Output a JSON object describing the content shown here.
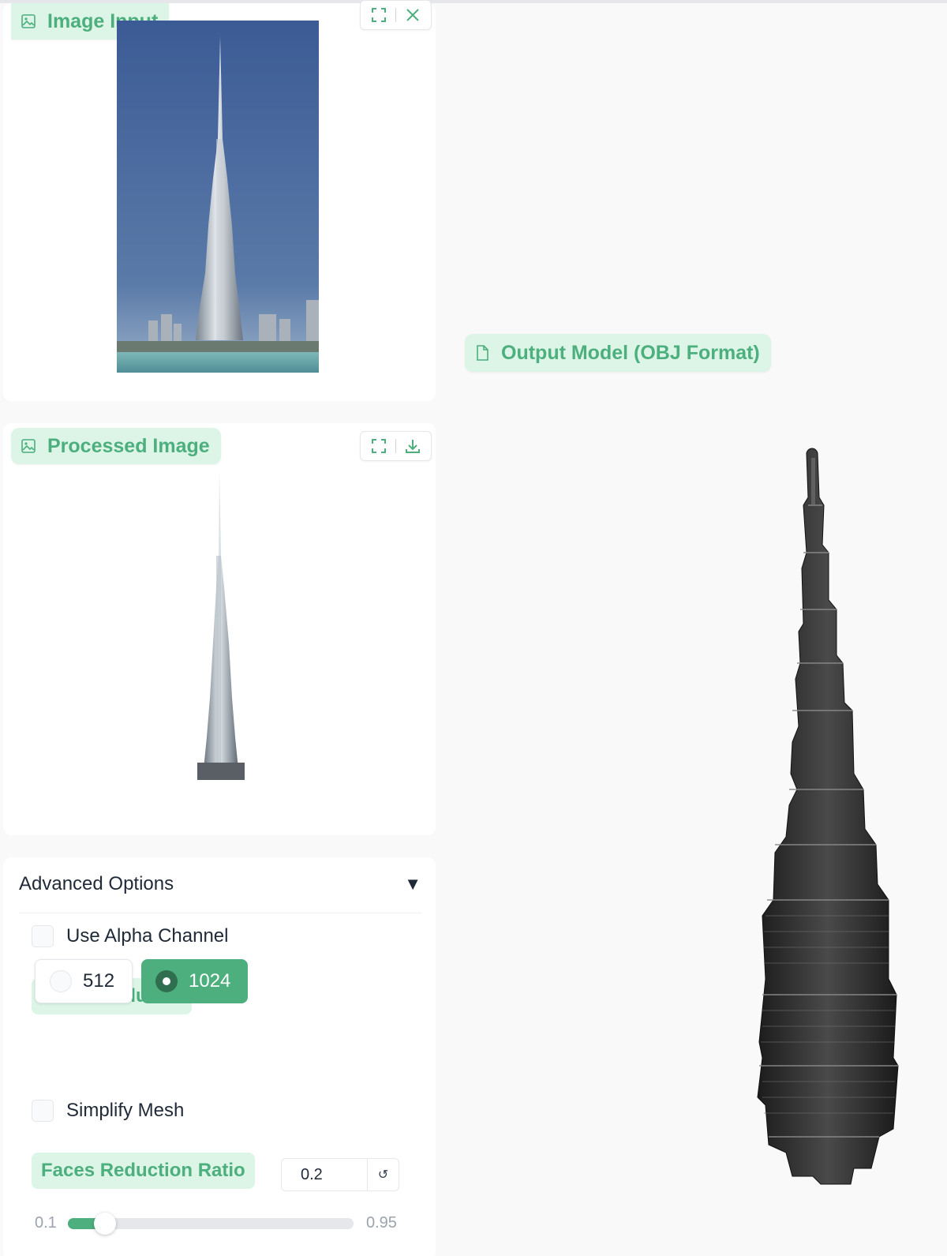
{
  "image_input": {
    "label": "Image Input",
    "label_icon": "image-icon",
    "toolbar": [
      "fullscreen-icon",
      "close-icon"
    ]
  },
  "processed_image": {
    "label": "Processed Image",
    "label_icon": "image-icon",
    "toolbar": [
      "fullscreen-icon",
      "download-icon"
    ]
  },
  "output_model": {
    "label": "Output Model (OBJ Format)",
    "label_icon": "file-icon"
  },
  "advanced_options": {
    "title": "Advanced Options",
    "toggle_glyph": "▼",
    "use_alpha_channel": {
      "label": "Use Alpha Channel",
      "checked": false
    },
    "sdf_resolution": {
      "label": "SDF Resolution",
      "options": [
        "512",
        "1024"
      ],
      "selected": "1024"
    },
    "simplify_mesh": {
      "label": "Simplify Mesh",
      "checked": false
    },
    "faces_reduction_ratio": {
      "label": "Faces Reduction Ratio",
      "value": "0.2",
      "reset_glyph": "↺",
      "min": "0.1",
      "max": "0.95",
      "numeric_min": 0.1,
      "numeric_max": 0.95,
      "numeric_value": 0.2
    }
  },
  "colors": {
    "accent": "#4caf7d",
    "accent_light": "#dcf5e7",
    "sky": "#3a5f9a",
    "model": "#2a2a2a"
  }
}
